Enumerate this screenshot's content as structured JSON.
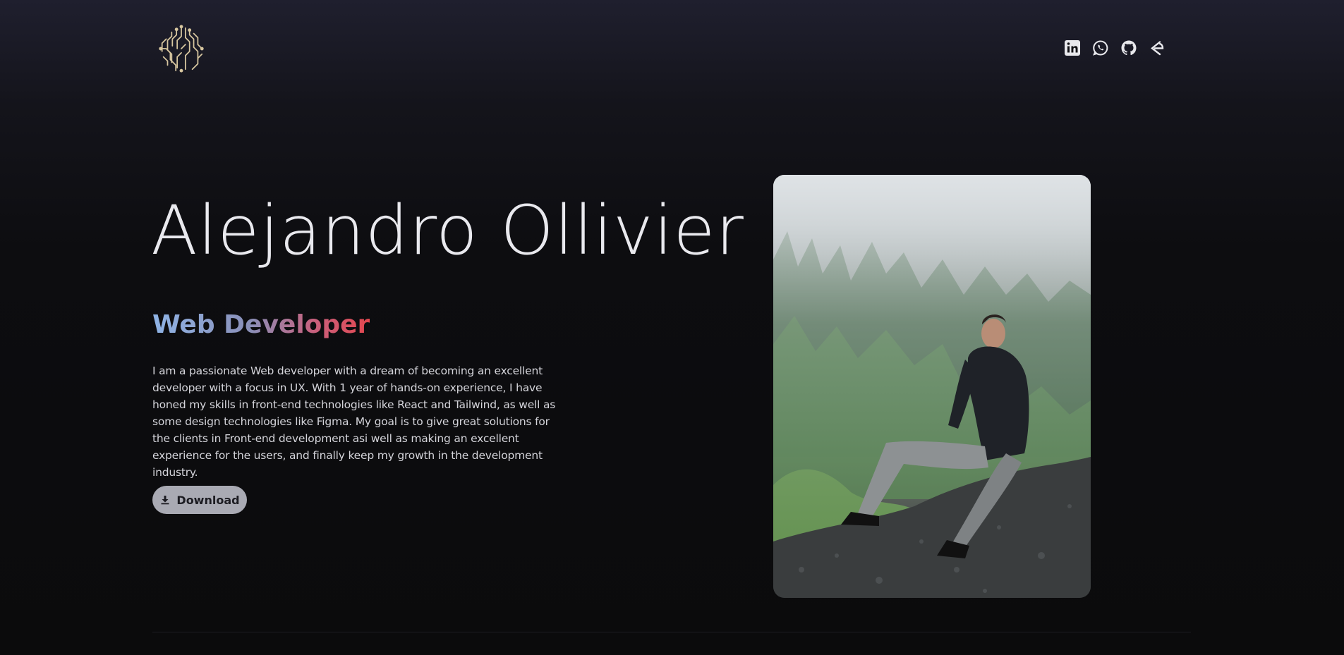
{
  "header": {
    "logo": {
      "icon": "circuit-brain-logo",
      "color": "#d8c7a0"
    },
    "socials": [
      {
        "name": "linkedin",
        "icon": "linkedin-icon"
      },
      {
        "name": "whatsapp",
        "icon": "whatsapp-icon"
      },
      {
        "name": "github",
        "icon": "github-icon"
      },
      {
        "name": "gitbook",
        "icon": "portfolio-link-icon"
      }
    ]
  },
  "hero": {
    "name": "Alejandro Ollivier",
    "role": "Web Developer",
    "bio": "I am a passionate Web developer with a dream of becoming an excellent developer with a focus in UX. With 1 year of hands-on experience, I have honed my skills in front-end technologies like React and Tailwind, as well as some design technologies like Figma. My goal is to give great solutions for the clients in Front-end development asi well as making an excellent experience for the users, and finally keep my growth in the development industry.",
    "download_label": "Download"
  },
  "colors": {
    "background": "#0b0b0c",
    "role_gradient": [
      "#8fb4e6",
      "#e4474f"
    ],
    "button_bg": "#a9aab3"
  }
}
